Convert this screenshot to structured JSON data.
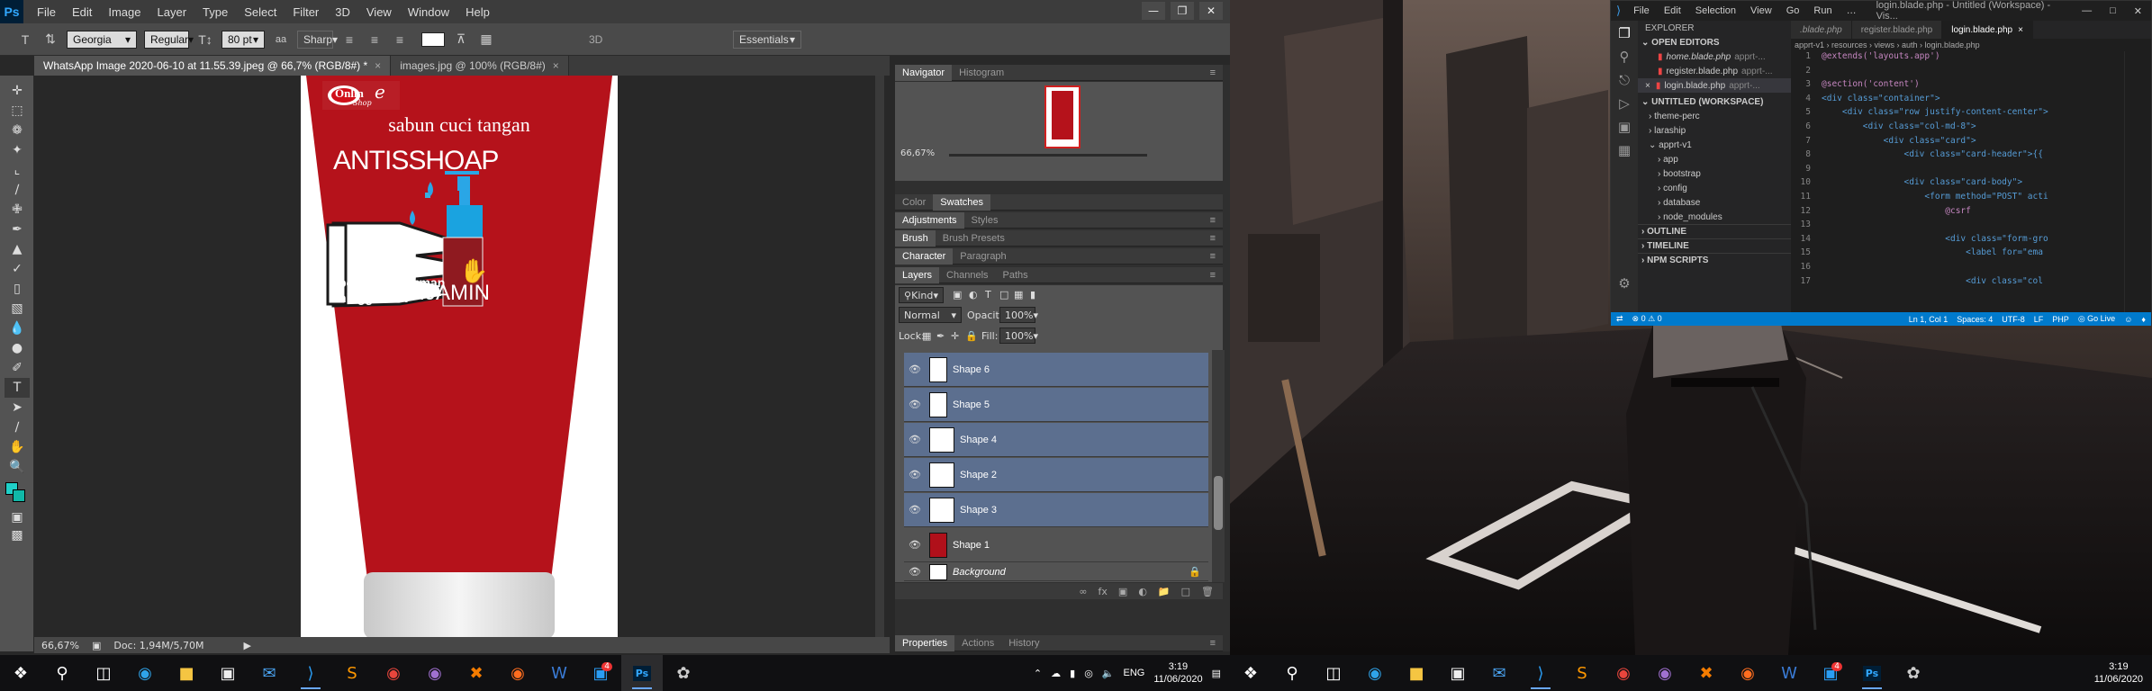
{
  "photoshop": {
    "app_icon": "Ps",
    "menu": [
      "File",
      "Edit",
      "Image",
      "Layer",
      "Type",
      "Select",
      "Filter",
      "3D",
      "View",
      "Window",
      "Help"
    ],
    "options": {
      "font_family": "Georgia",
      "font_style": "Regular",
      "font_size": "80 pt",
      "aa_icon": "aa",
      "antialias": "Sharp",
      "mode_3d": "3D",
      "workspace": "Essentials"
    },
    "tabs": [
      "WhatsApp Image 2020-06-10 at 11.55.39.jpeg @ 66,7% (RGB/8#) *",
      "images.jpg @ 100% (RGB/8#)"
    ],
    "artwork": {
      "logo_main": "Onlin",
      "logo_cursive": "e",
      "logo_sub": "Shop",
      "headline": "sabun cuci tangan",
      "brand": "ANTISSHOAP",
      "line1": "pembasmi kuman",
      "line2": "hingga 99%",
      "line3": "DIJAMIN"
    },
    "status": {
      "zoom": "66,67%",
      "doc": "Doc: 1,94M/5,70M"
    },
    "panels": {
      "nav_tabs": [
        "Navigator",
        "Histogram"
      ],
      "nav_zoom": "66,67%",
      "color_tabs": [
        "Color",
        "Swatches"
      ],
      "adj_tabs": [
        "Adjustments",
        "Styles"
      ],
      "brush_tabs": [
        "Brush",
        "Brush Presets"
      ],
      "char_tabs": [
        "Character",
        "Paragraph"
      ],
      "layer_tabs": [
        "Layers",
        "Channels",
        "Paths"
      ],
      "kind": "Kind",
      "blend": "Normal",
      "opacity_label": "Opacity:",
      "opacity": "100%",
      "lock_label": "Lock:",
      "fill_label": "Fill:",
      "fill": "100%",
      "layers": [
        "Shape 6",
        "Shape 5",
        "Shape 4",
        "Shape 2",
        "Shape 3",
        "Shape 1",
        "Background"
      ],
      "bottom_tabs": [
        "Properties",
        "Actions",
        "History"
      ]
    }
  },
  "taskbar": {
    "lang": "ENG",
    "time": "3:19",
    "date": "11/06/2020",
    "badge": "4"
  },
  "vscode": {
    "menu": [
      "File",
      "Edit",
      "Selection",
      "View",
      "Go",
      "Run",
      "…"
    ],
    "title": "login.blade.php - Untitled (Workspace) - Vis...",
    "explorer": "EXPLORER",
    "open_editors": "OPEN EDITORS",
    "open_files": [
      "home.blade.php",
      "register.blade.php",
      "login.blade.php"
    ],
    "open_hint": "apprt-...",
    "workspace": "UNTITLED (WORKSPACE)",
    "tree": [
      "theme-perc",
      "laraship",
      "apprt-v1",
      "app",
      "bootstrap",
      "config",
      "database",
      "node_modules"
    ],
    "sections": [
      "OUTLINE",
      "TIMELINE",
      "NPM SCRIPTS"
    ],
    "tabs": [
      ".blade.php",
      "register.blade.php",
      "login.blade.php"
    ],
    "breadcrumb": "apprt-v1 › resources › views › auth › login.blade.php",
    "code": [
      {
        "n": "1",
        "t": "@extends('layouts.app')"
      },
      {
        "n": "2",
        "t": ""
      },
      {
        "n": "3",
        "t": "@section('content')"
      },
      {
        "n": "4",
        "t": "<div class=\"container\">"
      },
      {
        "n": "5",
        "t": "    <div class=\"row justify-content-center\">"
      },
      {
        "n": "6",
        "t": "        <div class=\"col-md-8\">"
      },
      {
        "n": "7",
        "t": "            <div class=\"card\">"
      },
      {
        "n": "8",
        "t": "                <div class=\"card-header\">{{"
      },
      {
        "n": "9",
        "t": ""
      },
      {
        "n": "10",
        "t": "                <div class=\"card-body\">"
      },
      {
        "n": "11",
        "t": "                    <form method=\"POST\" acti"
      },
      {
        "n": "12",
        "t": "                        @csrf"
      },
      {
        "n": "13",
        "t": ""
      },
      {
        "n": "14",
        "t": "                        <div class=\"form-gro"
      },
      {
        "n": "15",
        "t": "                            <label for=\"ema"
      },
      {
        "n": "16",
        "t": ""
      },
      {
        "n": "17",
        "t": "                            <div class=\"col"
      }
    ],
    "status": {
      "errors": "⊗ 0 ⚠ 0",
      "position": "Ln 1, Col 1",
      "spaces": "Spaces: 4",
      "encoding": "UTF-8",
      "eol": "LF",
      "lang": "PHP",
      "golive": "Go Live"
    }
  }
}
